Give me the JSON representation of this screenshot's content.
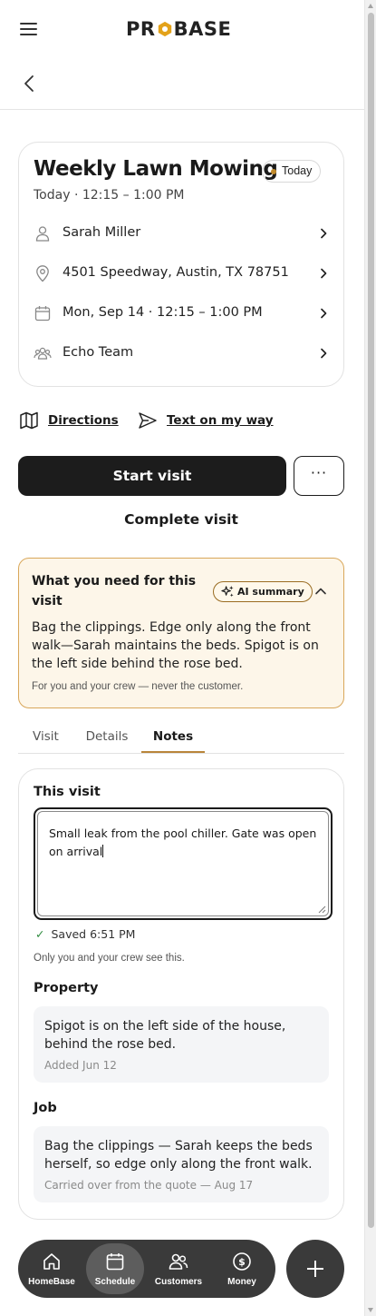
{
  "header": {
    "logo_text_left": "PR",
    "logo_text_right": "BASE"
  },
  "visit": {
    "title": "Weekly Lawn Mowing",
    "badge": "Today",
    "time": "Today · 12:15 – 1:00 PM",
    "rows": [
      {
        "icon": "person-icon",
        "text": "Sarah Miller"
      },
      {
        "icon": "location-pin-icon",
        "text": "4501 Speedway, Austin, TX 78751"
      },
      {
        "icon": "calendar-icon",
        "text": "Mon, Sep 14 · 12:15 – 1:00 PM"
      },
      {
        "icon": "team-icon",
        "text": "Echo Team"
      }
    ]
  },
  "actions": {
    "directions": "Directions",
    "text_on_my_way": "Text on my way",
    "start_visit": "Start visit",
    "more": "···",
    "complete_visit": "Complete visit"
  },
  "ai_card": {
    "heading": "What you need for this visit",
    "pill": "AI summary",
    "body": "Bag the clippings. Edge only along the front walk—Sarah maintains the beds. Spigot is on the left side behind the rose bed.",
    "footnote": "For you and your crew — never the customer.",
    "accent": "#d9a75a",
    "background": "#fdf6e9"
  },
  "tabs": [
    {
      "label": "Visit",
      "active": false
    },
    {
      "label": "Details",
      "active": false
    },
    {
      "label": "Notes",
      "active": true
    }
  ],
  "notes": {
    "this_visit_title": "This visit",
    "this_visit_value": "Small leak from the pool chiller. Gate was open on arrival",
    "saved_status": "Saved 6:51 PM",
    "crew_visibility": "Only you and your crew see this.",
    "property_title": "Property",
    "property_text": "Spigot is on the left side of the house, behind the rose bed.",
    "property_meta": "Added Jun 12",
    "job_title": "Job",
    "job_text": "Bag the clippings — Sarah keeps the beds herself, so edge only along the front walk.",
    "job_meta": "Carried over from the quote — Aug 17"
  },
  "bottom_nav": {
    "items": [
      {
        "label": "HomeBase",
        "icon": "home-icon",
        "active": false
      },
      {
        "label": "Schedule",
        "icon": "calendar-icon",
        "active": true
      },
      {
        "label": "Customers",
        "icon": "customers-icon",
        "active": false
      },
      {
        "label": "Money",
        "icon": "dollar-icon",
        "active": false
      }
    ],
    "fab_icon": "plus-icon"
  }
}
